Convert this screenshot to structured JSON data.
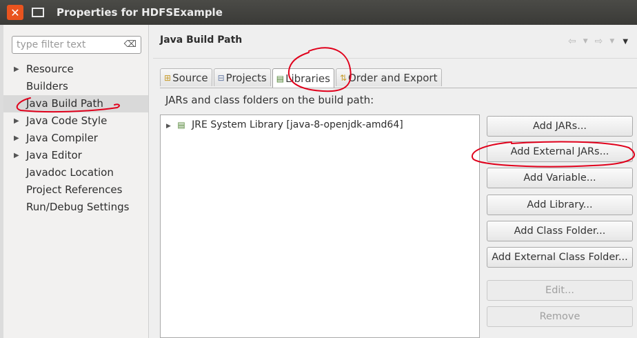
{
  "window": {
    "title": "Properties for HDFSExample",
    "close_glyph": "✕"
  },
  "sidebar": {
    "filter_placeholder": "type filter text",
    "items": [
      {
        "label": "Resource",
        "expandable": true
      },
      {
        "label": "Builders",
        "expandable": false
      },
      {
        "label": "Java Build Path",
        "expandable": false,
        "selected": true
      },
      {
        "label": "Java Code Style",
        "expandable": true
      },
      {
        "label": "Java Compiler",
        "expandable": true
      },
      {
        "label": "Java Editor",
        "expandable": true
      },
      {
        "label": "Javadoc Location",
        "expandable": false
      },
      {
        "label": "Project References",
        "expandable": false
      },
      {
        "label": "Run/Debug Settings",
        "expandable": false
      }
    ]
  },
  "main": {
    "title": "Java Build Path",
    "tabs": [
      {
        "label": "Source",
        "icon": "source-folder-icon"
      },
      {
        "label": "Projects",
        "icon": "projects-icon"
      },
      {
        "label": "Libraries",
        "icon": "libraries-icon",
        "active": true
      },
      {
        "label": "Order and Export",
        "icon": "order-export-icon"
      }
    ],
    "description": "JARs and class folders on the build path:",
    "libraries": [
      {
        "label": "JRE System Library [java-8-openjdk-amd64]",
        "icon": "library-icon"
      }
    ],
    "buttons": [
      {
        "label": "Add JARs...",
        "enabled": true
      },
      {
        "label": "Add External JARs...",
        "enabled": true
      },
      {
        "label": "Add Variable...",
        "enabled": true
      },
      {
        "label": "Add Library...",
        "enabled": true
      },
      {
        "label": "Add Class Folder...",
        "enabled": true
      },
      {
        "label": "Add External Class Folder...",
        "enabled": true
      },
      {
        "label": "Edit...",
        "enabled": false
      },
      {
        "label": "Remove",
        "enabled": false
      }
    ]
  },
  "colors": {
    "titlebar": "#3c3b37",
    "close_button": "#e9541f",
    "annotation": "#e0001b"
  }
}
